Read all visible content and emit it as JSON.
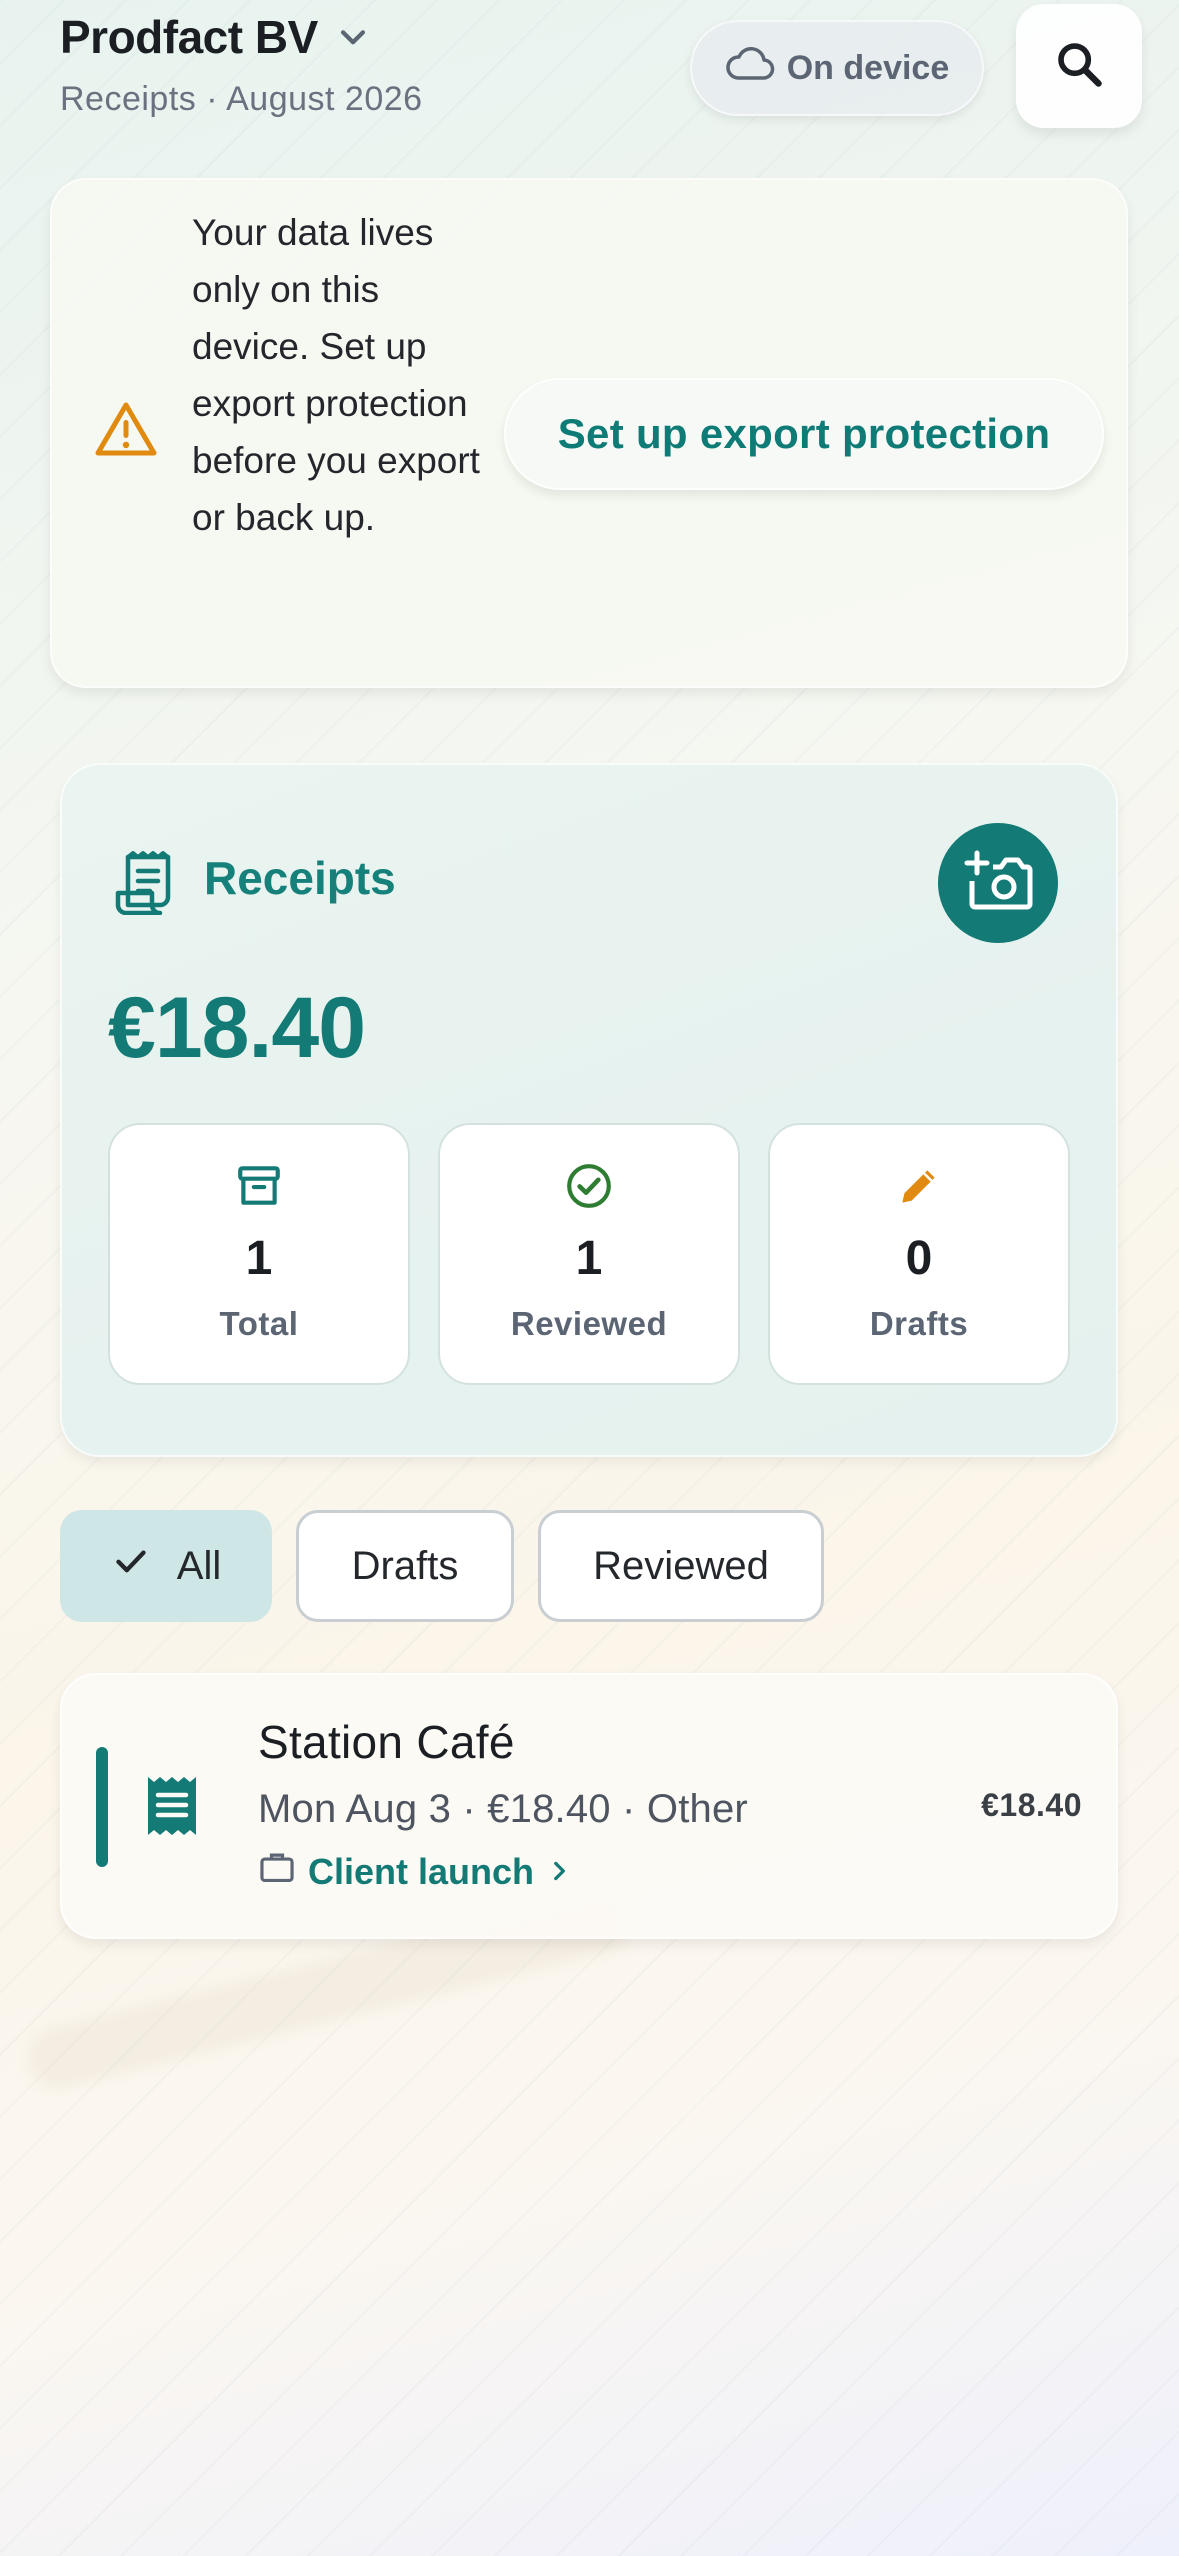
{
  "header": {
    "company": "Prodfact BV",
    "subtitle": "Receipts · August 2026",
    "storage_label": "On device"
  },
  "warning": {
    "message": "Your data lives only on this device. Set up export protection before you export or back up.",
    "action_label": "Set up export protection"
  },
  "receipts_card": {
    "title": "Receipts",
    "total_amount": "€18.40",
    "stats": [
      {
        "value": "1",
        "label": "Total"
      },
      {
        "value": "1",
        "label": "Reviewed"
      },
      {
        "value": "0",
        "label": "Drafts"
      }
    ]
  },
  "filters": {
    "selected": "All",
    "options": [
      "All",
      "Drafts",
      "Reviewed"
    ]
  },
  "receipts": [
    {
      "merchant": "Station Café",
      "meta": "Mon Aug 3 · €18.40 · Other",
      "project": "Client launch",
      "amount": "€18.40"
    }
  ],
  "colors": {
    "accent": "#137a75",
    "warning": "#e08a10",
    "success": "#2e7d32"
  }
}
